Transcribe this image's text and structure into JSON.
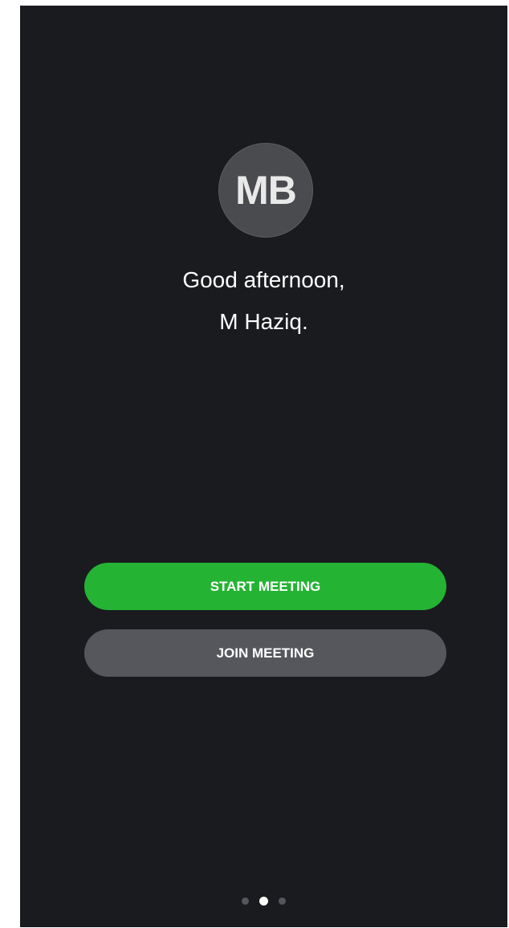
{
  "avatar": {
    "initials": "MB"
  },
  "greeting": {
    "line1": "Good afternoon,",
    "line2": "M Haziq."
  },
  "actions": {
    "start_meeting_label": "START MEETING",
    "join_meeting_label": "JOIN MEETING"
  },
  "pager": {
    "total_pages": 3,
    "active_page": 2
  },
  "colors": {
    "background": "#1a1b1f",
    "start_button": "#25b334",
    "join_button": "#55575c",
    "avatar": "#4a4b4f",
    "active_dot": "#ffffff",
    "inactive_dot": "#55575c"
  }
}
